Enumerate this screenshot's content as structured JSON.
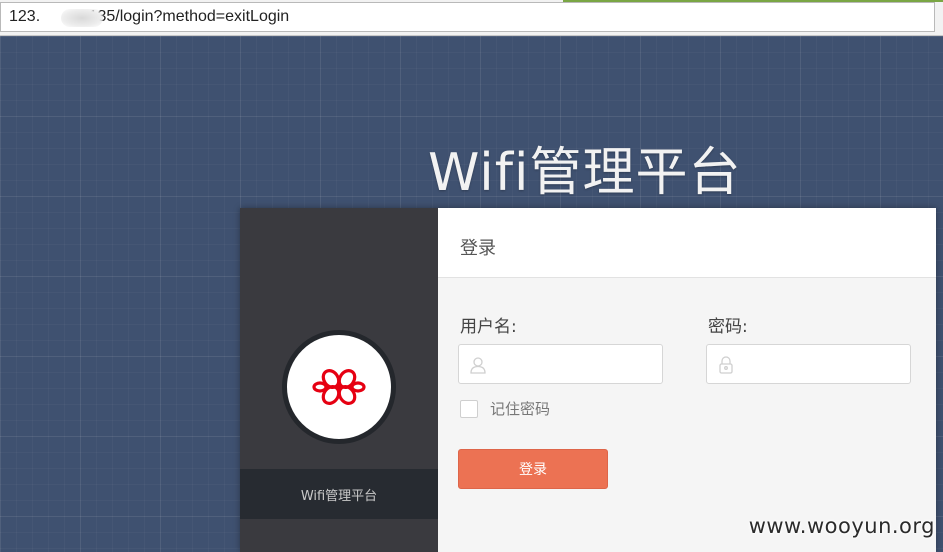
{
  "browser": {
    "url_prefix": "123.",
    "url_suffix": ".135/login?method=exitLogin"
  },
  "page": {
    "title": "Wifi管理平台"
  },
  "card": {
    "left_caption": "Wifi管理平台",
    "logo_icon": "china-unicom-knot-icon",
    "logo_color": "#e60012",
    "panel_title": "登录",
    "username_label": "用户名:",
    "username_value": "",
    "username_icon": "user-icon",
    "password_label": "密码:",
    "password_value": "",
    "password_icon": "lock-icon",
    "remember_label": "记住密码",
    "remember_checked": false,
    "login_button": "登录",
    "button_color": "#ec7253"
  },
  "watermark": "www.wooyun.org"
}
